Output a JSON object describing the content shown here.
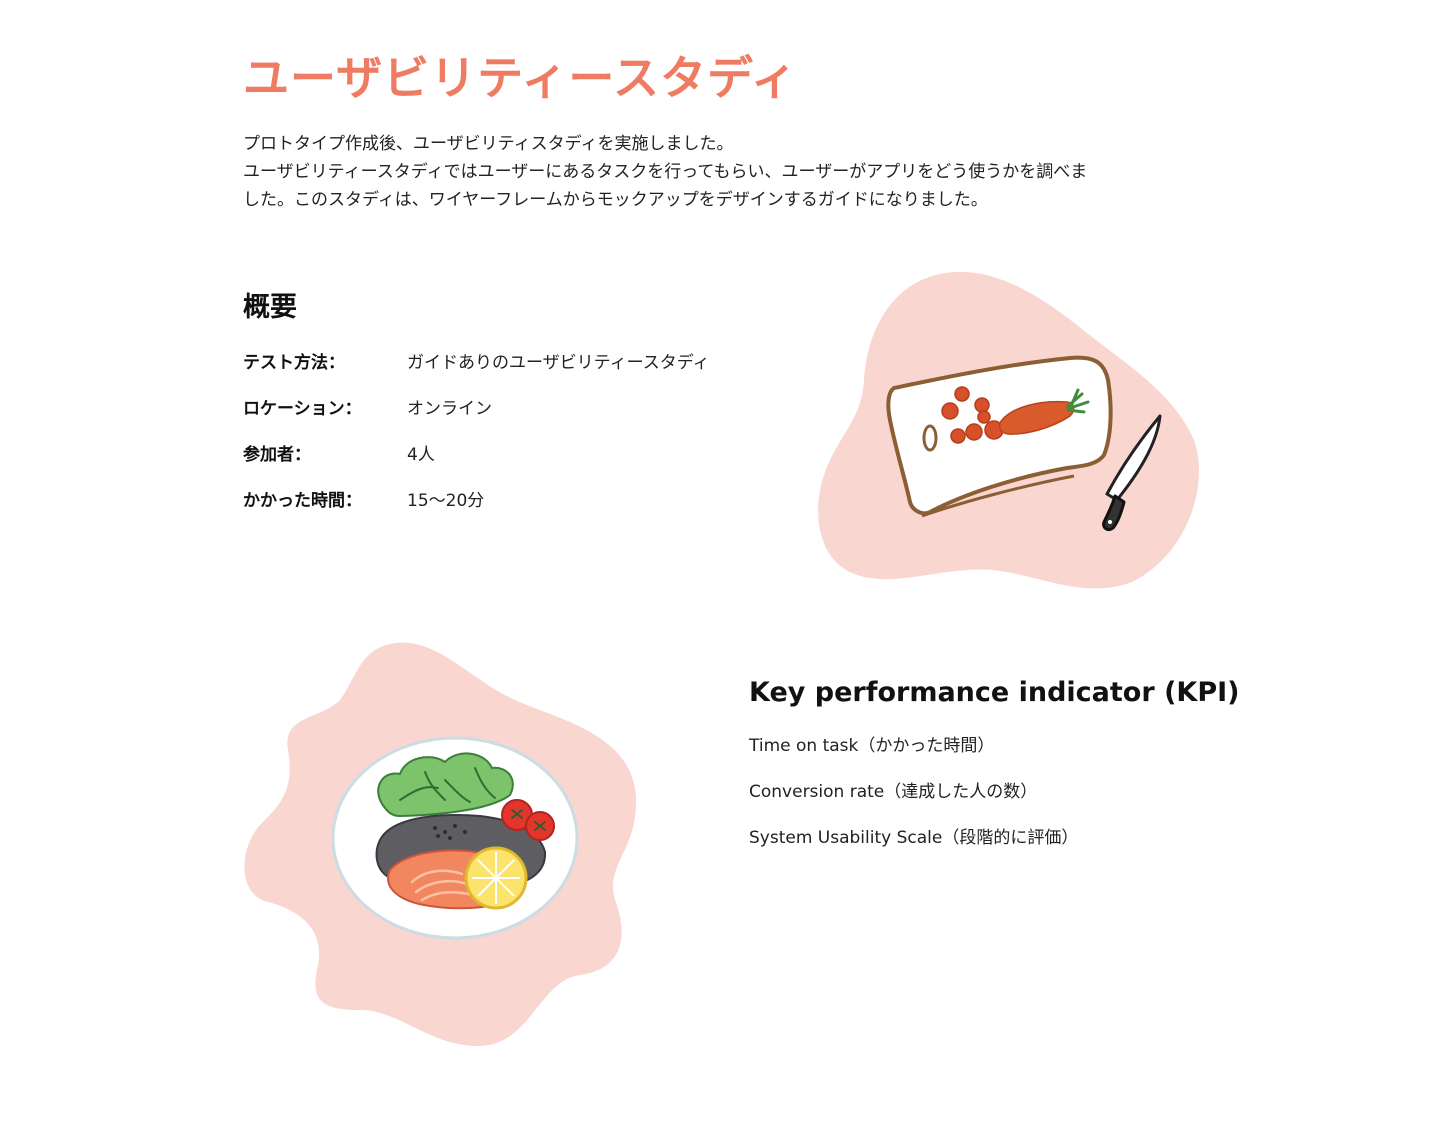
{
  "colors": {
    "accent": "#EE7B62",
    "blob": "#FAD6D1",
    "text": "#222222"
  },
  "page": {
    "title": "ユーザビリティースタディ",
    "intro_lines": [
      "プロトタイプ作成後、ユーザビリティスタディを実施しました。",
      "ユーザビリティースタディではユーザーにあるタスクを行ってもらい、ユーザーがアプリをどう使うかを調べま",
      "した。このスタディは、ワイヤーフレームからモックアップをデザインするガイドになりました。"
    ]
  },
  "overview": {
    "heading": "概要",
    "rows": [
      {
        "label": "テスト方法：",
        "value": "ガイドありのユーザビリティースタディ"
      },
      {
        "label": "ロケーション：",
        "value": "オンライン"
      },
      {
        "label": "参加者：",
        "value": "4人"
      },
      {
        "label": "かかった時間：",
        "value": "15〜20分"
      }
    ]
  },
  "kpi": {
    "heading": "Key performance indicator (KPI)",
    "items": [
      "Time on task（かかった時間）",
      "Conversion rate（達成した人の数）",
      "System Usability Scale（段階的に評価）"
    ]
  },
  "illustrations": {
    "top": "cutting-board-carrot-knife-icon",
    "bottom": "salmon-plate-icon"
  }
}
